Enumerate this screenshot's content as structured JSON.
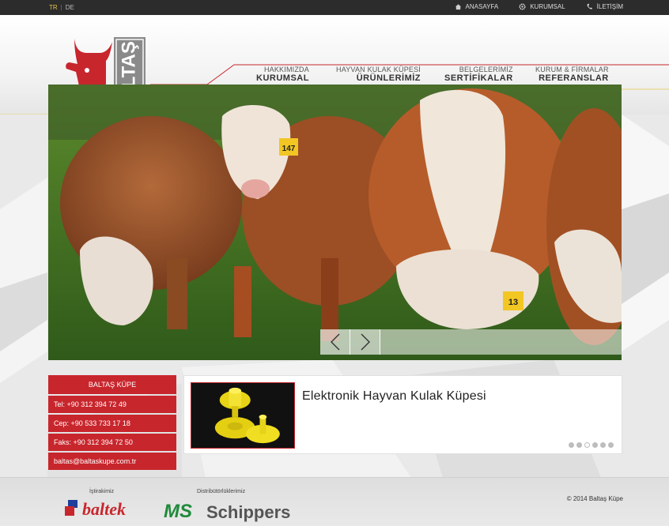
{
  "topbar": {
    "lang_tr": "TR",
    "lang_sep": "|",
    "lang_de": "DE",
    "links": [
      {
        "label": "ANASAYFA",
        "icon": "home-icon"
      },
      {
        "label": "KURUMSAL",
        "icon": "gear-icon"
      },
      {
        "label": "İLETİŞİM",
        "icon": "phone-icon"
      }
    ]
  },
  "logo": {
    "text": "BALTAŞ"
  },
  "nav": [
    {
      "small": "HAKKIMIZDA",
      "big": "KURUMSAL"
    },
    {
      "small": "HAYVAN KULAK KÜPESİ",
      "big": "ÜRÜNLERİMİZ"
    },
    {
      "small": "BELGELERİMİZ",
      "big": "SERTİFİKALAR"
    },
    {
      "small": "KURUM & FİRMALAR",
      "big": "REFERANSLAR"
    }
  ],
  "slider": {
    "tag_left": "147",
    "tag_right": "13"
  },
  "contact": {
    "title": "BALTAŞ KÜPE",
    "tel": "Tel:   +90 312 394 72 49",
    "cep": "Cep:  +90 533 733 17 18",
    "faks": "Faks: +90 312 394 72 50",
    "email": "baltas@baltaskupe.com.tr"
  },
  "product": {
    "title": "Elektronik Hayvan Kulak Küpesi",
    "dots_total": 6,
    "dots_active_index": 2
  },
  "footer": {
    "label_affiliate": "İştirakimiz",
    "label_distributors": "Distribütörlüklerimiz",
    "brand_baltek": "baltek",
    "brand_ms": "MS",
    "brand_schippers": "Schippers",
    "copyright": "© 2014 Baltaş Küpe"
  },
  "colors": {
    "accent_red": "#c8262d",
    "topbar": "#2c2c2c",
    "lang_active": "#e6c14a",
    "schippers_green": "#1f8a3b"
  }
}
